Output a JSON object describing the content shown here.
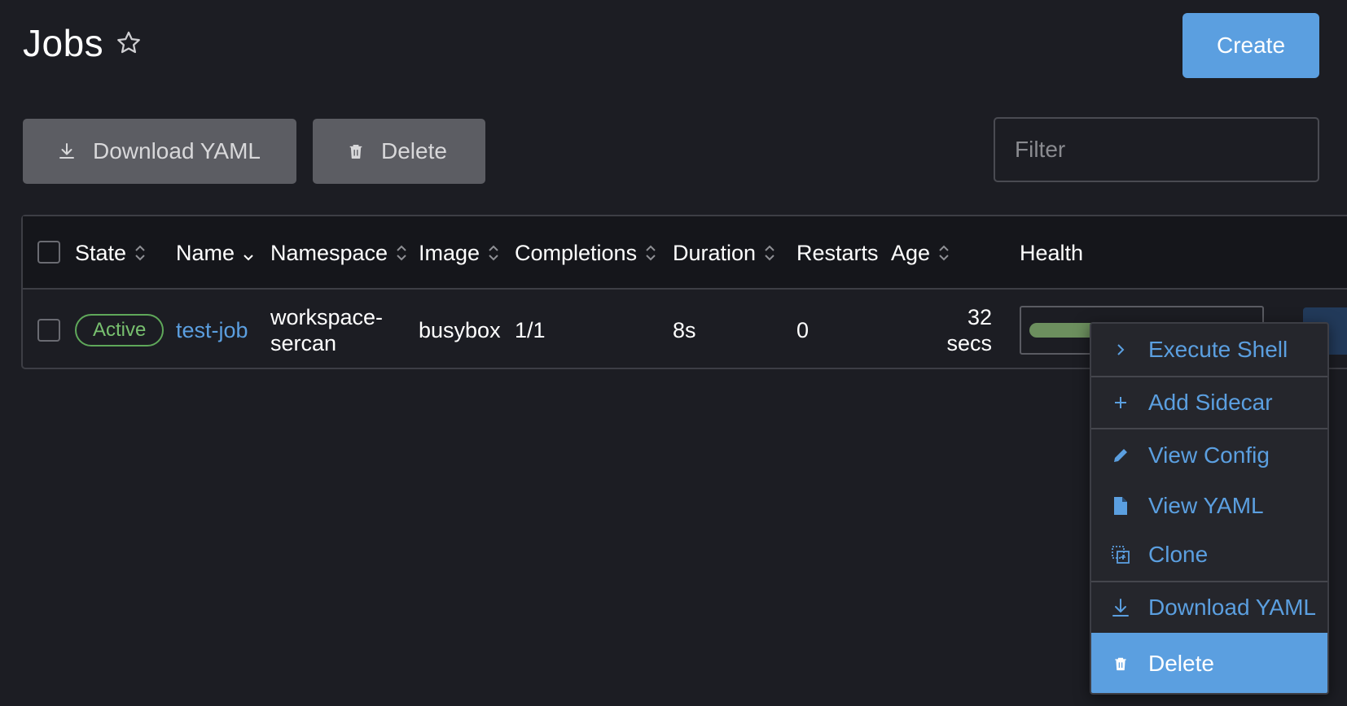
{
  "header": {
    "title": "Jobs",
    "create_label": "Create"
  },
  "bulk_actions": {
    "download_yaml_label": "Download YAML",
    "delete_label": "Delete"
  },
  "filter": {
    "placeholder": "Filter"
  },
  "table": {
    "columns": {
      "state": "State",
      "name": "Name",
      "namespace": "Namespace",
      "image": "Image",
      "completions": "Completions",
      "duration": "Duration",
      "restarts": "Restarts",
      "age": "Age",
      "health": "Health"
    },
    "rows": [
      {
        "state": "Active",
        "name": "test-job",
        "namespace_line1": "workspace-",
        "namespace_line2": "sercan",
        "image": "busybox",
        "completions": "1/1",
        "duration": "8s",
        "restarts": "0",
        "age_line1": "32",
        "age_line2": "secs",
        "health_fraction": 0.35
      }
    ]
  },
  "row_menu": {
    "items": [
      {
        "label": "Execute Shell",
        "icon": "chevron-right-icon"
      },
      {
        "label": "Add Sidecar",
        "icon": "plus-icon"
      },
      {
        "label": "View Config",
        "icon": "pencil-icon"
      },
      {
        "label": "View YAML",
        "icon": "file-icon"
      },
      {
        "label": "Clone",
        "icon": "clone-icon"
      },
      {
        "label": "Download YAML",
        "icon": "download-icon"
      },
      {
        "label": "Delete",
        "icon": "trash-icon"
      }
    ]
  },
  "colors": {
    "background": "#1c1d23",
    "accent": "#5b9fe0",
    "active_state": "#78c06f",
    "health_fill": "#6c8f5e"
  }
}
